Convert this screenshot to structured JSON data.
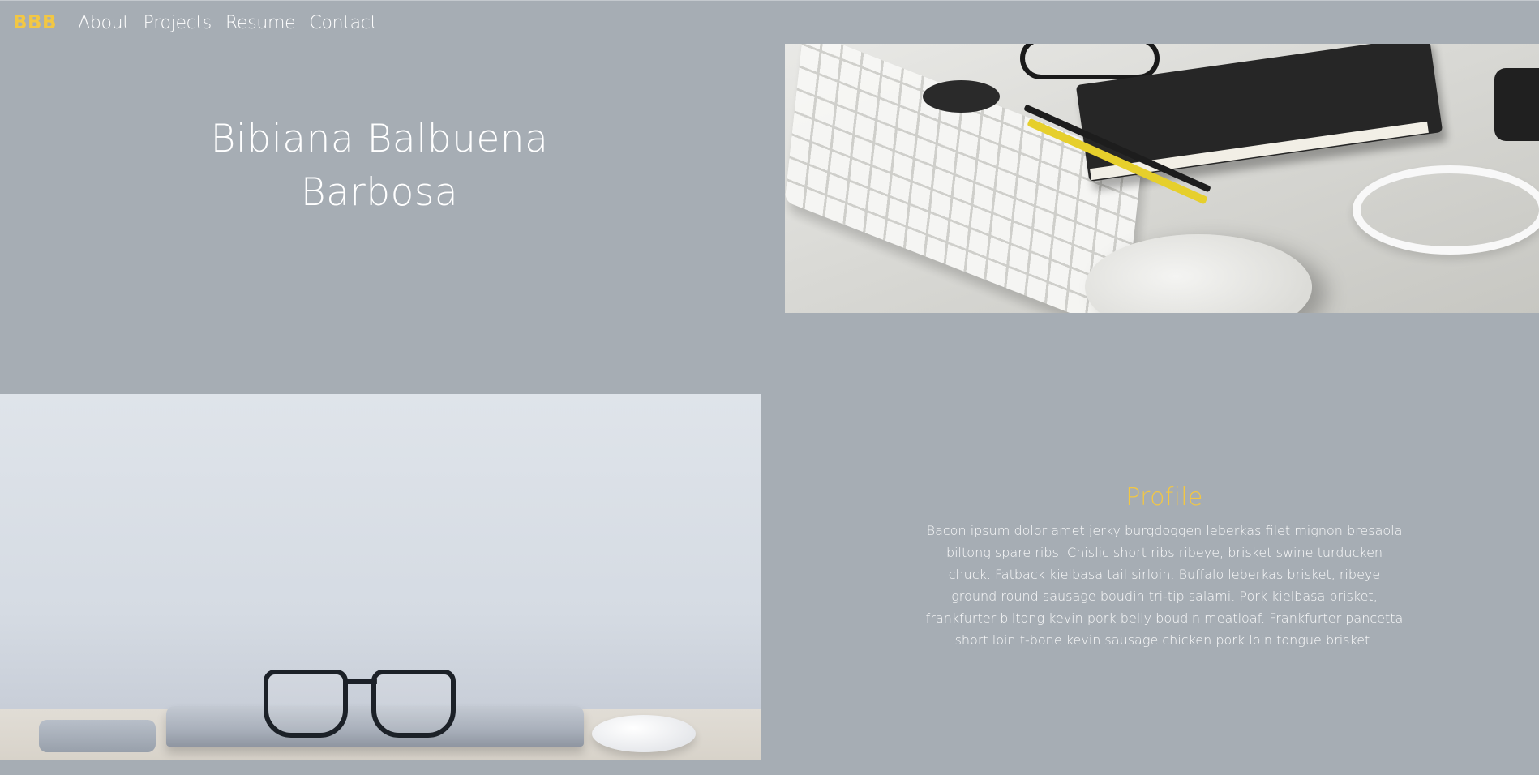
{
  "nav": {
    "brand": "BBB",
    "links": [
      {
        "label": "About"
      },
      {
        "label": "Projects"
      },
      {
        "label": "Resume"
      },
      {
        "label": "Contact"
      }
    ]
  },
  "hero": {
    "name_line1": "Bibiana Balbuena",
    "name_line2": "Barbosa"
  },
  "images": {
    "desk_photo": "desk-workspace-photo",
    "laptop_photo": "laptop-glasses-photo"
  },
  "profile": {
    "title": "Profile",
    "text": "Bacon ipsum dolor amet jerky burgdoggen leberkas filet mignon bresaola biltong spare ribs. Chislic short ribs ribeye, brisket swine turducken chuck. Fatback kielbasa tail sirloin. Buffalo leberkas brisket, ribeye ground round sausage boudin tri-tip salami. Pork kielbasa brisket, frankfurter biltong kevin pork belly boudin meatloaf. Frankfurter pancetta short loin t-bone kevin sausage chicken pork loin tongue brisket."
  },
  "colors": {
    "background": "#a6adb4",
    "accent": "#f2c744",
    "text": "#ffffff"
  }
}
